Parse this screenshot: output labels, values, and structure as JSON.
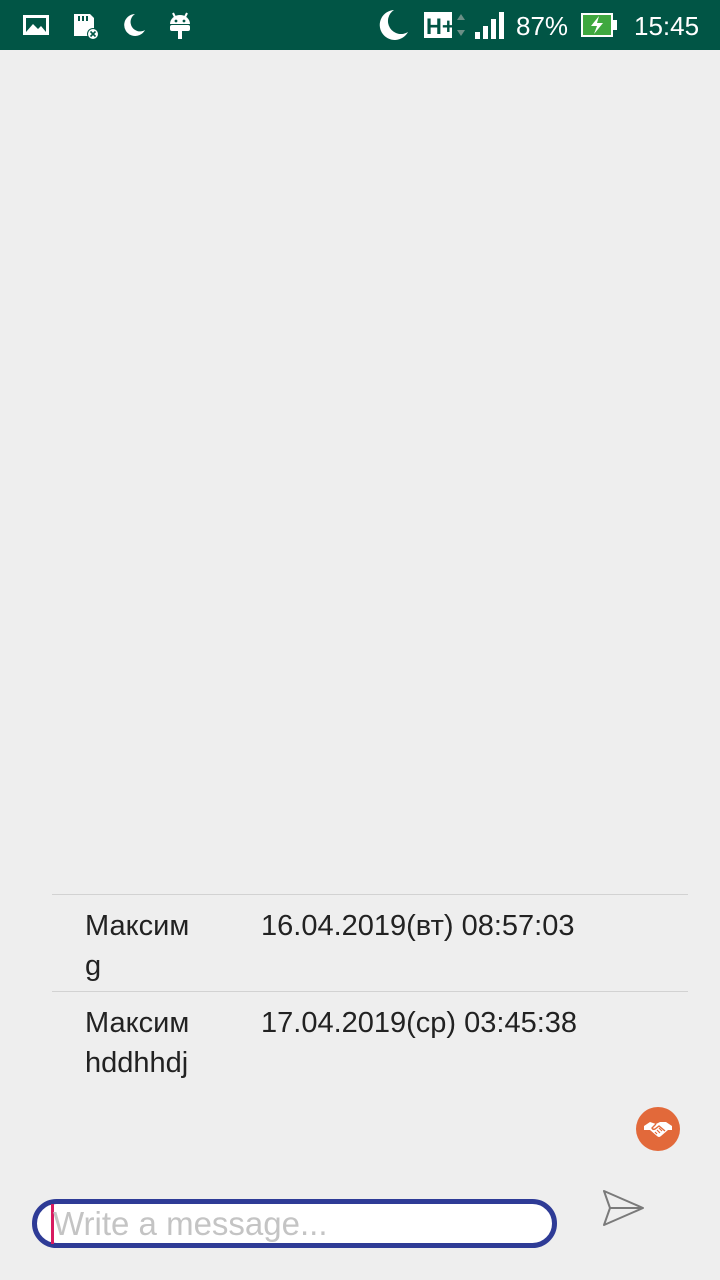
{
  "status_bar": {
    "battery_percent": "87%",
    "time": "15:45",
    "network_type": "H+",
    "icons": [
      "gallery-icon",
      "sd-card-icon",
      "night-mode-icon",
      "android-debug-icon",
      "do-not-disturb-icon",
      "network-hplus-icon",
      "signal-icon",
      "battery-charging-icon"
    ],
    "background_color": "#015545"
  },
  "messages": [
    {
      "author": "Максим",
      "text": "g",
      "timestamp": "16.04.2019(вт) 08:57:03"
    },
    {
      "author": "Максим",
      "text": "hddhhdj",
      "timestamp": "17.04.2019(ср) 03:45:38"
    }
  ],
  "composer": {
    "placeholder": "Write a message...",
    "value": "",
    "border_color": "#2e3b96",
    "send_icon": "send-icon"
  },
  "fab": {
    "icon": "handshake-icon",
    "color": "#e2693a"
  }
}
